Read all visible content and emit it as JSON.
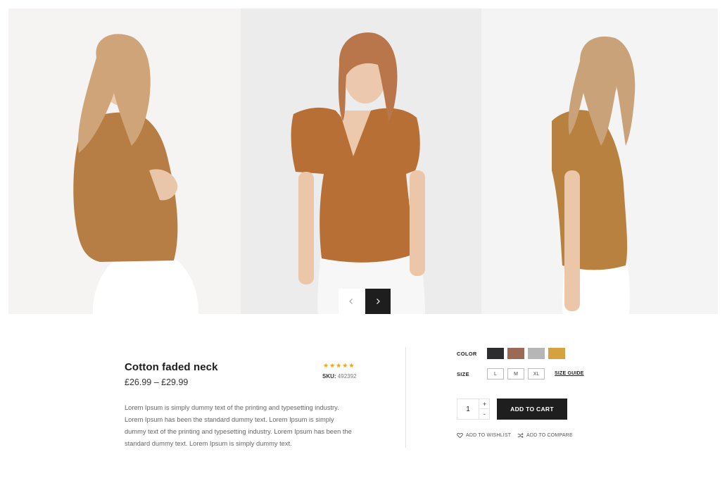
{
  "product": {
    "title": "Cotton faded neck",
    "price": "£26.99 – £29.99",
    "rating_stars": [
      "★",
      "★",
      "★",
      "★",
      "★"
    ],
    "sku_label": "SKU:",
    "sku_value": "492392",
    "description": "Lorem Ipsum is simply dummy text of the printing and typesetting industry. Lorem Ipsum has been the standard dummy text. Lorem Ipsum is simply dummy text of the printing and typesetting industry. Lorem Ipsum has been the standard dummy text. Lorem Ipsum is simply dummy text."
  },
  "colors": {
    "star": "#f0a21b",
    "dark_button": "#1e1e1e",
    "swatches": [
      "#2d2d2f",
      "#9b6a57",
      "#b6b6b6",
      "#d4a23e"
    ],
    "shirt": "#b9773e"
  },
  "options": {
    "color_label": "COLOR",
    "size_label": "SIZE",
    "sizes": [
      "L",
      "M",
      "XL"
    ],
    "size_guide": "SIZE GUIDE"
  },
  "cart": {
    "quantity": "1",
    "plus": "+",
    "minus": "-",
    "add_to_cart": "ADD TO CART"
  },
  "actions": {
    "wishlist": "ADD TO WISHLIST",
    "compare": "ADD TO COMPARE"
  },
  "icons": {
    "prev": "chevron-left-icon",
    "next": "chevron-right-icon",
    "wishlist": "heart-icon",
    "compare": "shuffle-icon"
  }
}
